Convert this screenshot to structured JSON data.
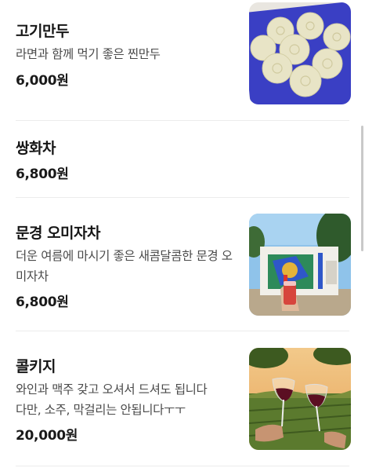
{
  "menu": {
    "items": [
      {
        "name": "고기만두",
        "description": "라면과 함께 먹기 좋은 찐만두",
        "price": "6,000원",
        "photo": "steamed-dumplings-photo"
      },
      {
        "name": "쌍화차",
        "price": "6,800원"
      },
      {
        "name": "문경 오미자차",
        "description": "더운 여름에 마시기 좋은 새콤달콤한 문경 오미자차",
        "price": "6,800원",
        "photo": "omija-tea-cafe-photo"
      },
      {
        "name": "콜키지",
        "description_lines": [
          "와인과 맥주 갖고 오셔서 드셔도 됩니다",
          "다만, 소주, 막걸리는 안됩니다ㅜㅜ"
        ],
        "price": "20,000원",
        "photo": "wine-glasses-vineyard-photo"
      }
    ]
  },
  "colors": {
    "divider": "#ececec",
    "plate_blue": "#3a3fc4",
    "text_primary": "#161616",
    "text_secondary": "#4a4a4a"
  }
}
